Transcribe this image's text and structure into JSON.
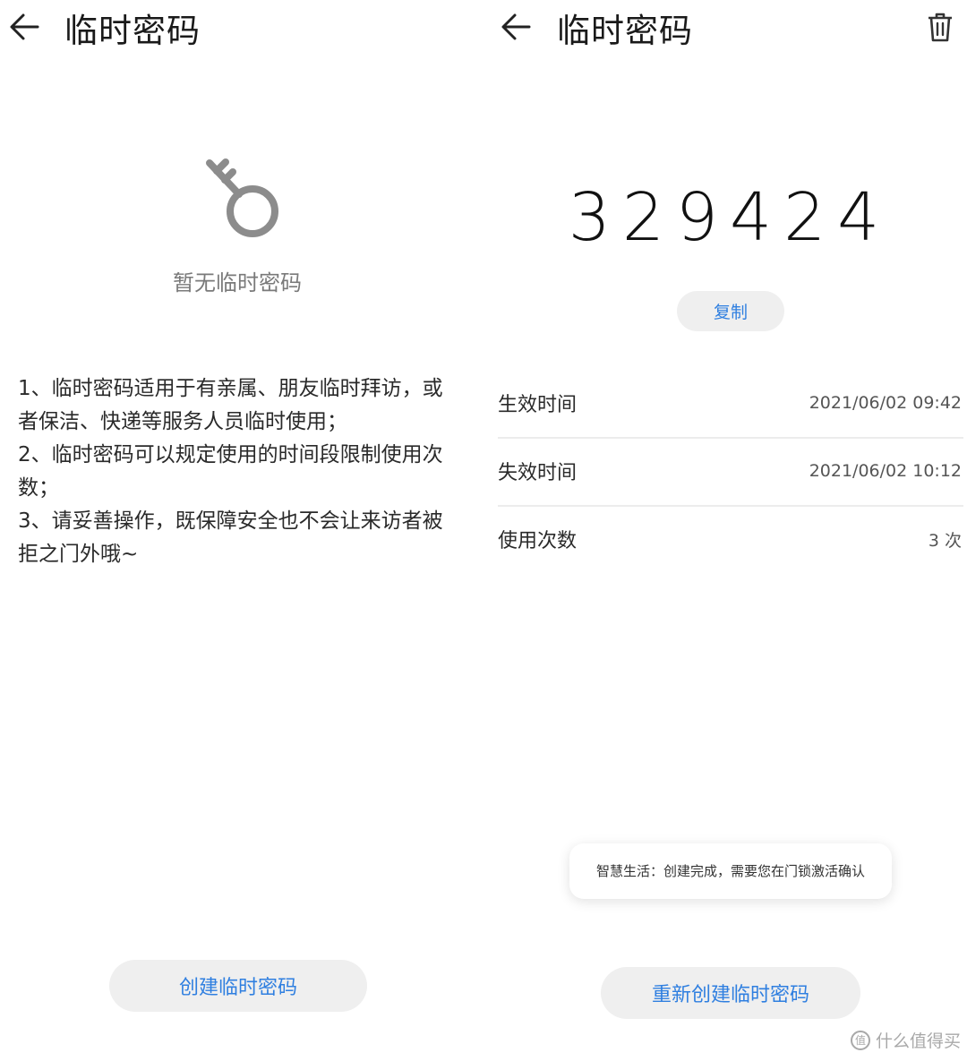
{
  "left": {
    "title": "临时密码",
    "empty_text": "暂无临时密码",
    "instructions": [
      "1、临时密码适用于有亲属、朋友临时拜访，或者保洁、快递等服务人员临时使用；",
      "2、临时密码可以规定使用的时间段限制使用次数；",
      "3、请妥善操作，既保障安全也不会让来访者被拒之门外哦~"
    ],
    "create_button": "创建临时密码"
  },
  "right": {
    "title": "临时密码",
    "code": "329424",
    "copy_button": "复制",
    "rows": [
      {
        "label": "生效时间",
        "value": "2021/06/02 09:42"
      },
      {
        "label": "失效时间",
        "value": "2021/06/02 10:12"
      },
      {
        "label": "使用次数",
        "value": "3 次"
      }
    ],
    "toast": "智慧生活：创建完成，需要您在门锁激活确认",
    "recreate_button": "重新创建临时密码"
  },
  "watermark": {
    "logo": "值",
    "text": "什么值得买"
  },
  "icons": {
    "back": "arrow-left-icon",
    "trash": "trash-icon",
    "key": "key-icon"
  },
  "colors": {
    "accent": "#2f7fe0",
    "button_bg": "#efefef",
    "muted_text": "#7a7a7a"
  }
}
